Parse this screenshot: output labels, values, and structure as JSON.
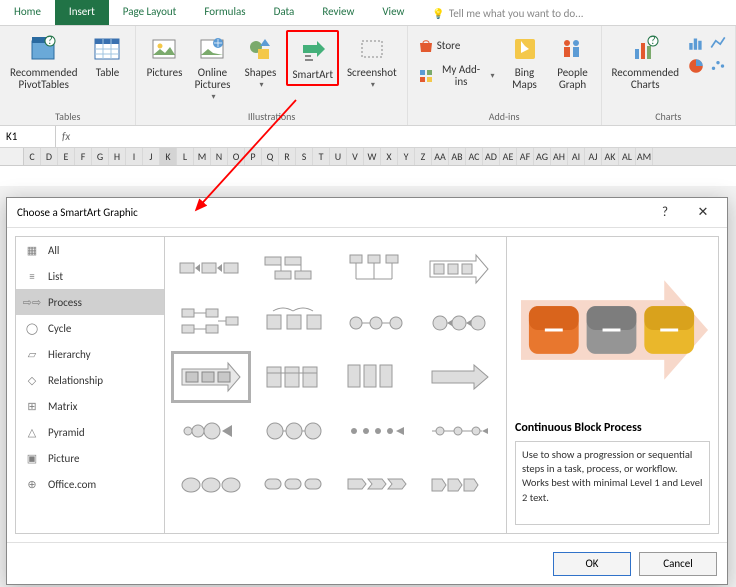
{
  "tabs": {
    "items": [
      "Home",
      "Insert",
      "Page Layout",
      "Formulas",
      "Data",
      "Review",
      "View"
    ],
    "active": "Insert",
    "tell_me": "Tell me what you want to do..."
  },
  "ribbon": {
    "groups": {
      "tables": {
        "label": "Tables",
        "recommended_pt": "Recommended\nPivotTables",
        "table": "Table"
      },
      "illustrations": {
        "label": "Illustrations",
        "pictures": "Pictures",
        "online_pics": "Online\nPictures",
        "shapes": "Shapes",
        "smartart": "SmartArt",
        "screenshot": "Screenshot"
      },
      "addins": {
        "label": "Add-ins",
        "store": "Store",
        "myaddins": "My Add-ins",
        "bing": "Bing\nMaps",
        "people": "People\nGraph"
      },
      "charts": {
        "label": "Charts",
        "recommended": "Recommended\nCharts"
      }
    }
  },
  "formula_bar": {
    "name_box": "K1",
    "fx": "fx"
  },
  "columns": [
    "C",
    "D",
    "E",
    "F",
    "G",
    "H",
    "I",
    "J",
    "K",
    "L",
    "M",
    "N",
    "O",
    "P",
    "Q",
    "R",
    "S",
    "T",
    "U",
    "V",
    "W",
    "X",
    "Y",
    "Z",
    "AA",
    "AB",
    "AC",
    "AD",
    "AE",
    "AF",
    "AG",
    "AH",
    "AI",
    "AJ",
    "AK",
    "AL",
    "AM"
  ],
  "sel_col": "K",
  "dialog": {
    "title": "Choose a SmartArt Graphic",
    "help": "?",
    "close": "✕",
    "categories": [
      {
        "icon": "all",
        "label": "All"
      },
      {
        "icon": "list",
        "label": "List"
      },
      {
        "icon": "process",
        "label": "Process"
      },
      {
        "icon": "cycle",
        "label": "Cycle"
      },
      {
        "icon": "hierarchy",
        "label": "Hierarchy"
      },
      {
        "icon": "relationship",
        "label": "Relationship"
      },
      {
        "icon": "matrix",
        "label": "Matrix"
      },
      {
        "icon": "pyramid",
        "label": "Pyramid"
      },
      {
        "icon": "picture",
        "label": "Picture"
      },
      {
        "icon": "office",
        "label": "Office.com"
      }
    ],
    "selected_category": "Process",
    "preview": {
      "title": "Continuous Block Process",
      "desc": "Use to show a progression or sequential steps in a task, process, or workflow. Works best with minimal Level 1 and Level 2 text.",
      "colors": {
        "block1": "#e8772e",
        "block2": "#858585",
        "block3": "#eab72b",
        "arrow": "#f4c8b4"
      }
    },
    "buttons": {
      "ok": "OK",
      "cancel": "Cancel"
    }
  }
}
